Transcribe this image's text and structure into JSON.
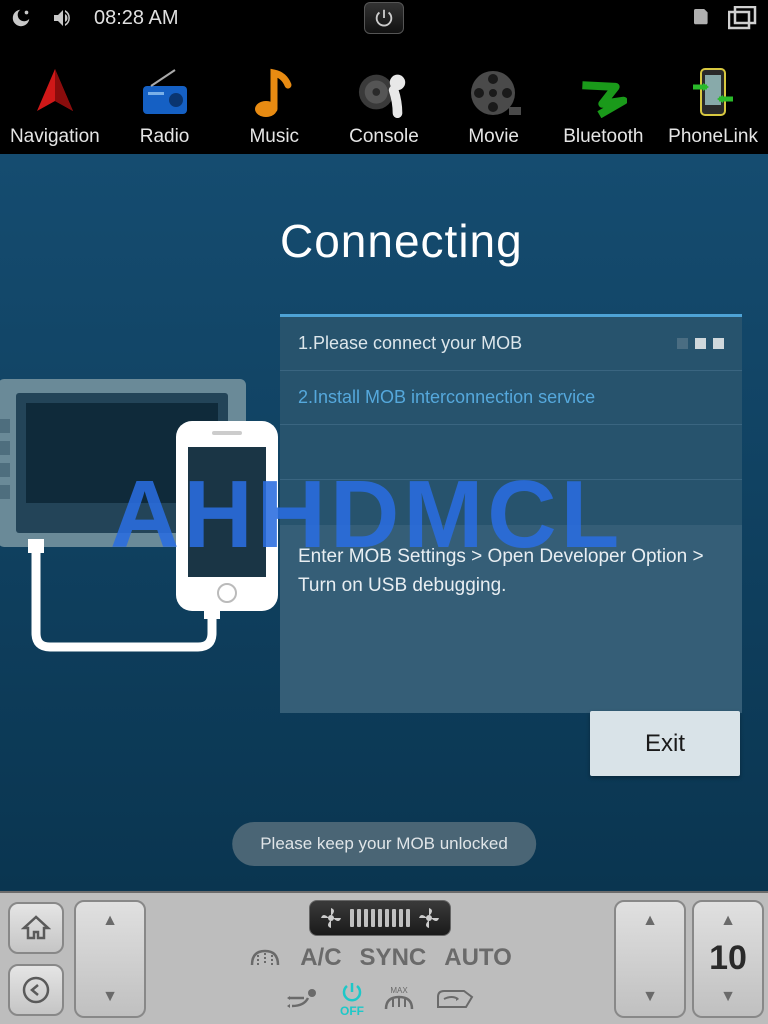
{
  "status": {
    "time": "08:28 AM"
  },
  "apps": [
    {
      "label": "Navigation"
    },
    {
      "label": "Radio"
    },
    {
      "label": "Music"
    },
    {
      "label": "Console"
    },
    {
      "label": "Movie"
    },
    {
      "label": "Bluetooth"
    },
    {
      "label": "PhoneLink"
    }
  ],
  "main": {
    "title": "Connecting",
    "step1": "1.Please connect your MOB",
    "step2": "2.Install MOB interconnection service",
    "detail": "Enter MOB Settings > Open Developer Option > Turn on USB debugging.",
    "exit": "Exit",
    "hint": "Please keep your MOB unlocked"
  },
  "watermark": "AHHDMCL",
  "climate": {
    "ac": "A/C",
    "sync": "SYNC",
    "auto": "AUTO",
    "off": "OFF",
    "temp": "10"
  }
}
